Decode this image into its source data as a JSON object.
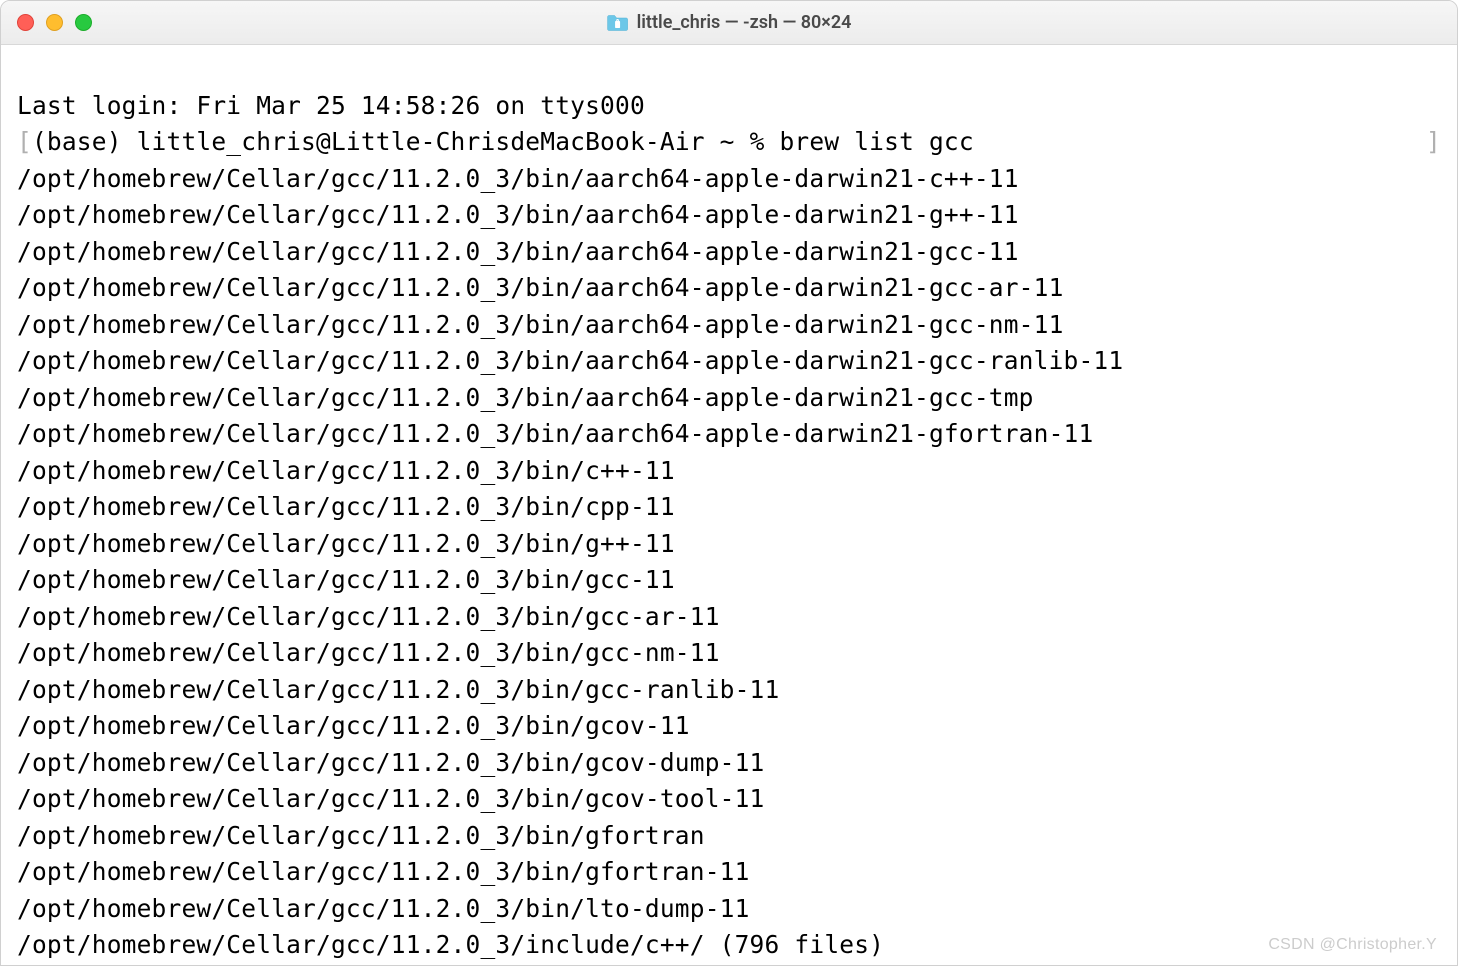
{
  "window": {
    "title": "little_chris — -zsh — 80×24"
  },
  "terminal": {
    "last_login": "Last login: Fri Mar 25 14:58:26 on ttys000",
    "prompt": "(base) little_chris@Little-ChrisdeMacBook-Air ~ % ",
    "command": "brew list gcc",
    "output": [
      "/opt/homebrew/Cellar/gcc/11.2.0_3/bin/aarch64-apple-darwin21-c++-11",
      "/opt/homebrew/Cellar/gcc/11.2.0_3/bin/aarch64-apple-darwin21-g++-11",
      "/opt/homebrew/Cellar/gcc/11.2.0_3/bin/aarch64-apple-darwin21-gcc-11",
      "/opt/homebrew/Cellar/gcc/11.2.0_3/bin/aarch64-apple-darwin21-gcc-ar-11",
      "/opt/homebrew/Cellar/gcc/11.2.0_3/bin/aarch64-apple-darwin21-gcc-nm-11",
      "/opt/homebrew/Cellar/gcc/11.2.0_3/bin/aarch64-apple-darwin21-gcc-ranlib-11",
      "/opt/homebrew/Cellar/gcc/11.2.0_3/bin/aarch64-apple-darwin21-gcc-tmp",
      "/opt/homebrew/Cellar/gcc/11.2.0_3/bin/aarch64-apple-darwin21-gfortran-11",
      "/opt/homebrew/Cellar/gcc/11.2.0_3/bin/c++-11",
      "/opt/homebrew/Cellar/gcc/11.2.0_3/bin/cpp-11",
      "/opt/homebrew/Cellar/gcc/11.2.0_3/bin/g++-11",
      "/opt/homebrew/Cellar/gcc/11.2.0_3/bin/gcc-11",
      "/opt/homebrew/Cellar/gcc/11.2.0_3/bin/gcc-ar-11",
      "/opt/homebrew/Cellar/gcc/11.2.0_3/bin/gcc-nm-11",
      "/opt/homebrew/Cellar/gcc/11.2.0_3/bin/gcc-ranlib-11",
      "/opt/homebrew/Cellar/gcc/11.2.0_3/bin/gcov-11",
      "/opt/homebrew/Cellar/gcc/11.2.0_3/bin/gcov-dump-11",
      "/opt/homebrew/Cellar/gcc/11.2.0_3/bin/gcov-tool-11",
      "/opt/homebrew/Cellar/gcc/11.2.0_3/bin/gfortran",
      "/opt/homebrew/Cellar/gcc/11.2.0_3/bin/gfortran-11",
      "/opt/homebrew/Cellar/gcc/11.2.0_3/bin/lto-dump-11",
      "/opt/homebrew/Cellar/gcc/11.2.0_3/include/c++/ (796 files)"
    ]
  },
  "watermark": "CSDN @Christopher.Y"
}
